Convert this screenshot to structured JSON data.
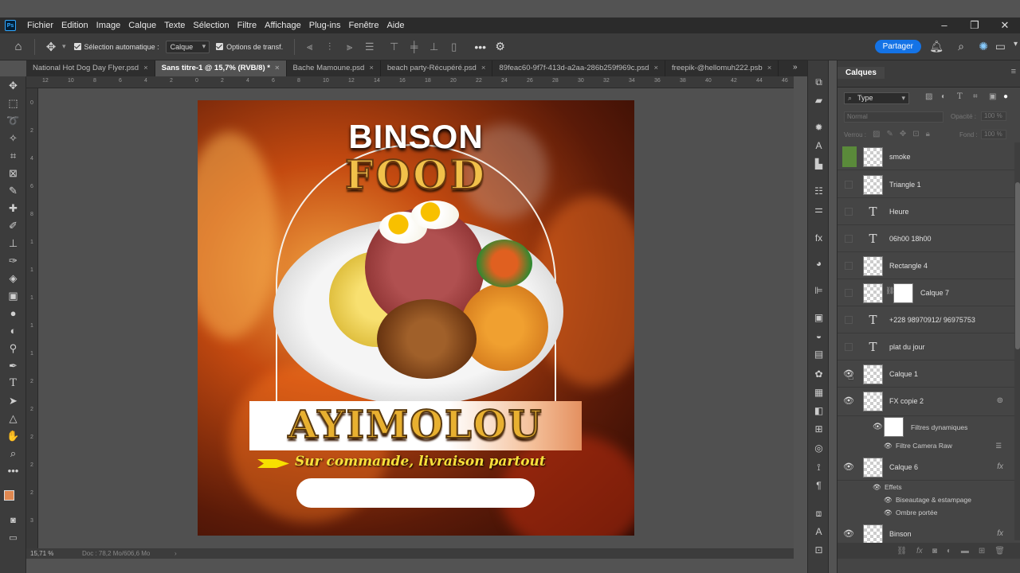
{
  "menubar": {
    "items": [
      "Fichier",
      "Edition",
      "Image",
      "Calque",
      "Texte",
      "Sélection",
      "Filtre",
      "Affichage",
      "Plug-ins",
      "Fenêtre",
      "Aide"
    ]
  },
  "options": {
    "auto_select_label": "Sélection automatique :",
    "auto_select_value": "Calque",
    "transform_label": "Options de transf.",
    "share_label": "Partager"
  },
  "tabs": [
    {
      "label": "National Hot Dog Day Flyer.psd",
      "active": false
    },
    {
      "label": "Sans titre-1 @ 15,7% (RVB/8) *",
      "active": true
    },
    {
      "label": "Bache Mamoune.psd",
      "active": false
    },
    {
      "label": "beach party-Récupéré.psd",
      "active": false
    },
    {
      "label": "89feac60-9f7f-413d-a2aa-286b259f969c.psd",
      "active": false
    },
    {
      "label": "freepik-@hellomuh222.psb",
      "active": false
    }
  ],
  "ruler": {
    "h_ticks": [
      "12",
      "10",
      "8",
      "6",
      "4",
      "2",
      "0",
      "2",
      "4",
      "6",
      "8",
      "10",
      "12",
      "14",
      "16",
      "18",
      "20",
      "22",
      "24",
      "26",
      "28",
      "30",
      "32",
      "34",
      "36",
      "38",
      "40",
      "42",
      "44",
      "46"
    ],
    "v_ticks": [
      "0",
      "2",
      "4",
      "6",
      "8",
      "1",
      "1",
      "1",
      "1",
      "1",
      "2",
      "2",
      "2",
      "2",
      "2",
      "3"
    ]
  },
  "artwork": {
    "title_line1": "BINSON",
    "title_line2": "FOOD",
    "dish_name": "AYIMOLOU",
    "slogan": "Sur commande, livraison partout"
  },
  "status": {
    "zoom": "15,71 %",
    "doc": "Doc : 78,2 Mo/606,6 Mo"
  },
  "layers_panel": {
    "title": "Calques",
    "filter": "Type",
    "blend_mode": "Normal",
    "opacity_label": "Opacité :",
    "opacity_value": "100 %",
    "lock_label": "Verrou :",
    "fill_label": "Fond :",
    "fill_value": "100 %",
    "layers": [
      {
        "name": "smoke",
        "type": "pixel",
        "visible": false
      },
      {
        "name": "Triangle 1",
        "type": "shape",
        "visible": false
      },
      {
        "name": "Heure",
        "type": "text",
        "visible": false
      },
      {
        "name": "06h00 18h00",
        "type": "text",
        "visible": false
      },
      {
        "name": "Rectangle 4",
        "type": "shape",
        "visible": false
      },
      {
        "name": "Calque 7",
        "type": "masked",
        "visible": false
      },
      {
        "name": "+228 98970912/ 96975753",
        "type": "text",
        "visible": false
      },
      {
        "name": "plat du jour",
        "type": "text",
        "visible": false
      },
      {
        "name": "Calque 1",
        "type": "pixel",
        "visible": true
      },
      {
        "name": "FX copie 2",
        "type": "smart",
        "visible": true
      },
      {
        "name": "Calque 6",
        "type": "pixel",
        "visible": true,
        "fx": "fx"
      },
      {
        "name": "Binson",
        "type": "pixel",
        "visible": true,
        "fx": "fx"
      }
    ],
    "smart_filters_label": "Filtres dynamiques",
    "camera_raw_label": "Filtre Camera Raw",
    "effects_label": "Effets",
    "effect1": "Biseautage & estampage",
    "effect2": "Ombre portée"
  }
}
